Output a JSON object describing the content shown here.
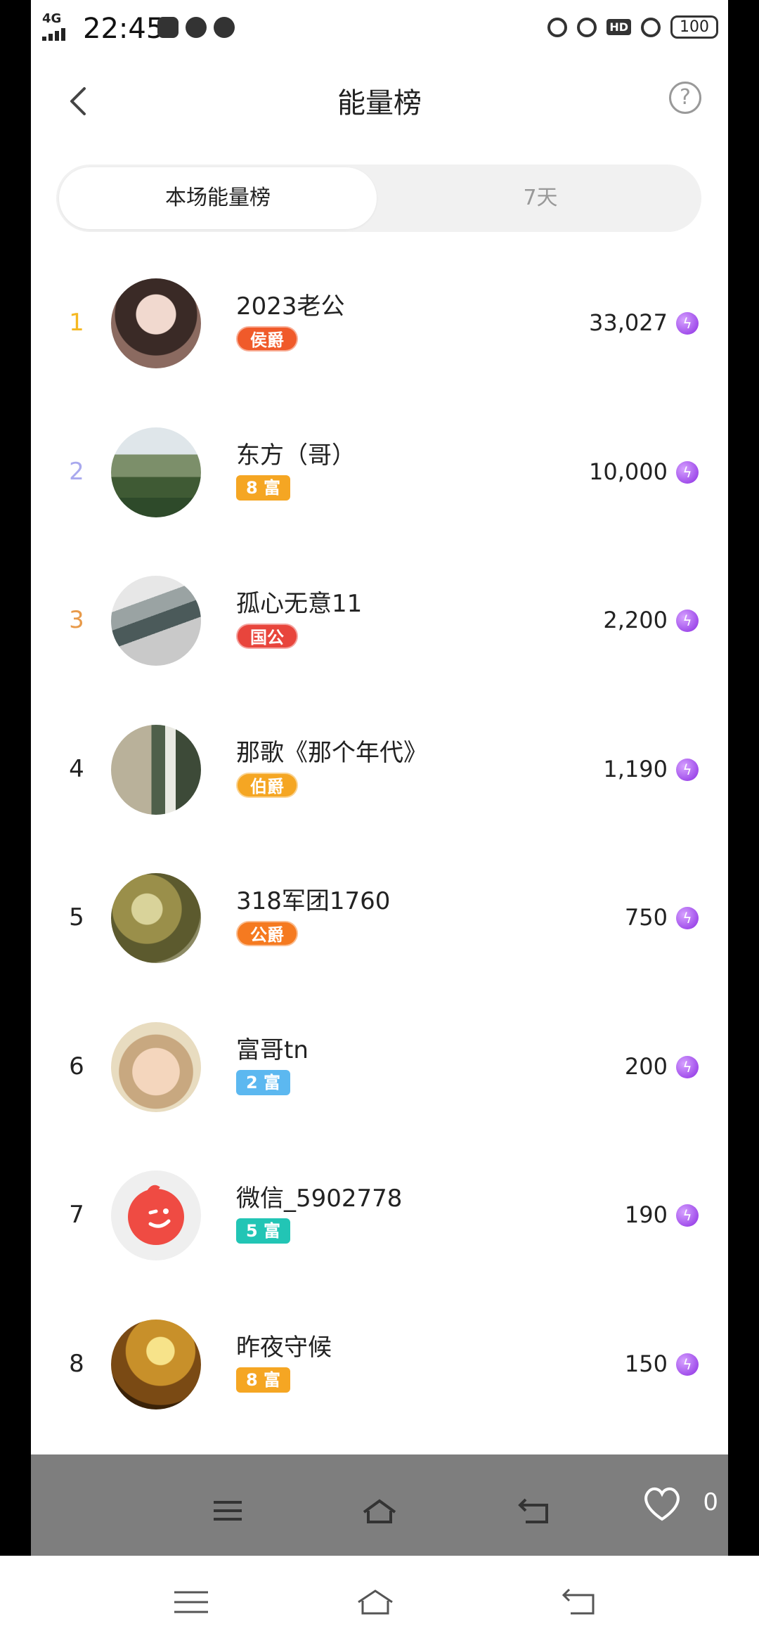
{
  "status_bar": {
    "time": "22:45",
    "network": "4G",
    "battery": "100"
  },
  "header": {
    "title": "能量榜"
  },
  "tabs": [
    {
      "label": "本场能量榜",
      "active": true
    },
    {
      "label": "7天",
      "active": false
    }
  ],
  "rankings": [
    {
      "rank": "1",
      "name": "2023老公",
      "badge": "侯爵",
      "badge_type": "noble",
      "energy": "33,027"
    },
    {
      "rank": "2",
      "name": "东方（哥）",
      "badge": "8 富",
      "badge_type": "rich",
      "energy": "10,000"
    },
    {
      "rank": "3",
      "name": "孤心无意11",
      "badge": "国公",
      "badge_type": "noble",
      "energy": "2,200"
    },
    {
      "rank": "4",
      "name": "那歌《那个年代》",
      "badge": "伯爵",
      "badge_type": "noble",
      "energy": "1,190"
    },
    {
      "rank": "5",
      "name": "318军团1760",
      "badge": "公爵",
      "badge_type": "noble",
      "energy": "750"
    },
    {
      "rank": "6",
      "name": "富哥tn",
      "badge": "2 富",
      "badge_type": "rich",
      "energy": "200"
    },
    {
      "rank": "7",
      "name": "微信_5902778",
      "badge": "5 富",
      "badge_type": "rich",
      "energy": "190"
    },
    {
      "rank": "8",
      "name": "昨夜守候",
      "badge": "8 富",
      "badge_type": "rich",
      "energy": "150"
    }
  ],
  "colors": {
    "rank1": "#f5b822",
    "rank2": "#a9a9ee",
    "rank3": "#e89a4a",
    "badge_houjue": "#f05a2a",
    "badge_8fu": "#f5a623",
    "badge_guogong": "#e8453c",
    "badge_bojue": "#f5a623",
    "badge_gongjue": "#f57a20",
    "badge_2fu": "#5cb8f0",
    "badge_5fu": "#22c5b5",
    "energy_icon": "#9b3be8"
  },
  "footer": {
    "like_count": "0"
  }
}
